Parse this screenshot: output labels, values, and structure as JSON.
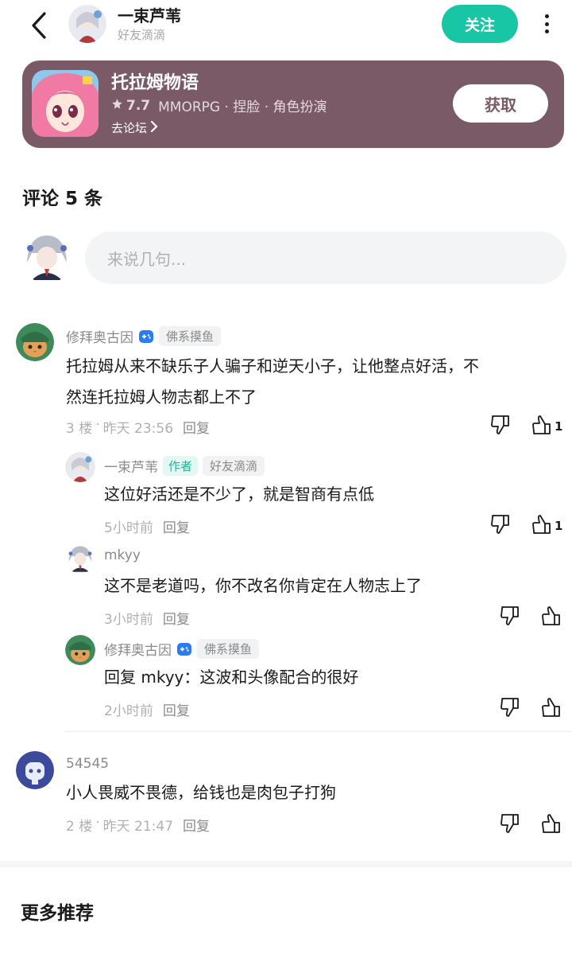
{
  "header": {
    "name": "一束芦苇",
    "subtitle": "好友滴滴",
    "follow_label": "关注"
  },
  "game": {
    "title": "托拉姆物语",
    "rating": "7.7",
    "tags": "MMORPG · 捏脸 · 角色扮演",
    "forum_label": "去论坛",
    "get_label": "获取"
  },
  "comments_section": {
    "title": "评论 5 条",
    "input_placeholder": "来说几句..."
  },
  "comments": [
    {
      "user": "修拜奥古因",
      "badge": "佛系摸鱼",
      "text_line1": "托拉姆从来不缺乐子人骗子和逆天小子，让他整点好活，不",
      "text_line2": "然连托拉姆人物志都上不了",
      "floor": "3 楼",
      "time": "昨天 23:56",
      "reply_label": "回复",
      "likes": "1"
    },
    {
      "user": "一束芦苇",
      "author_badge": "作者",
      "badge": "好友滴滴",
      "text": "这位好活还是不少了，就是智商有点低",
      "time": "5小时前",
      "reply_label": "回复",
      "likes": "1"
    },
    {
      "user": "mkyy",
      "text": "这不是老道吗，你不改名你肯定在人物志上了",
      "time": "3小时前",
      "reply_label": "回复"
    },
    {
      "user": "修拜奥古因",
      "badge": "佛系摸鱼",
      "text": "回复 mkyy：这波和头像配合的很好",
      "time": "2小时前",
      "reply_label": "回复"
    },
    {
      "user": "54545",
      "text": "小人畏威不畏德，给钱也是肉包子打狗",
      "floor": "2 楼",
      "time": "昨天 21:47",
      "reply_label": "回复"
    }
  ],
  "more_section": {
    "title": "更多推荐"
  },
  "colors": {
    "accent": "#18c5a4",
    "game_card_bg": "#7a5a66"
  },
  "icons": [
    "back-icon",
    "more-icon",
    "chevron-right-icon",
    "star-icon",
    "gamepad-icon",
    "dislike-icon",
    "like-icon"
  ]
}
